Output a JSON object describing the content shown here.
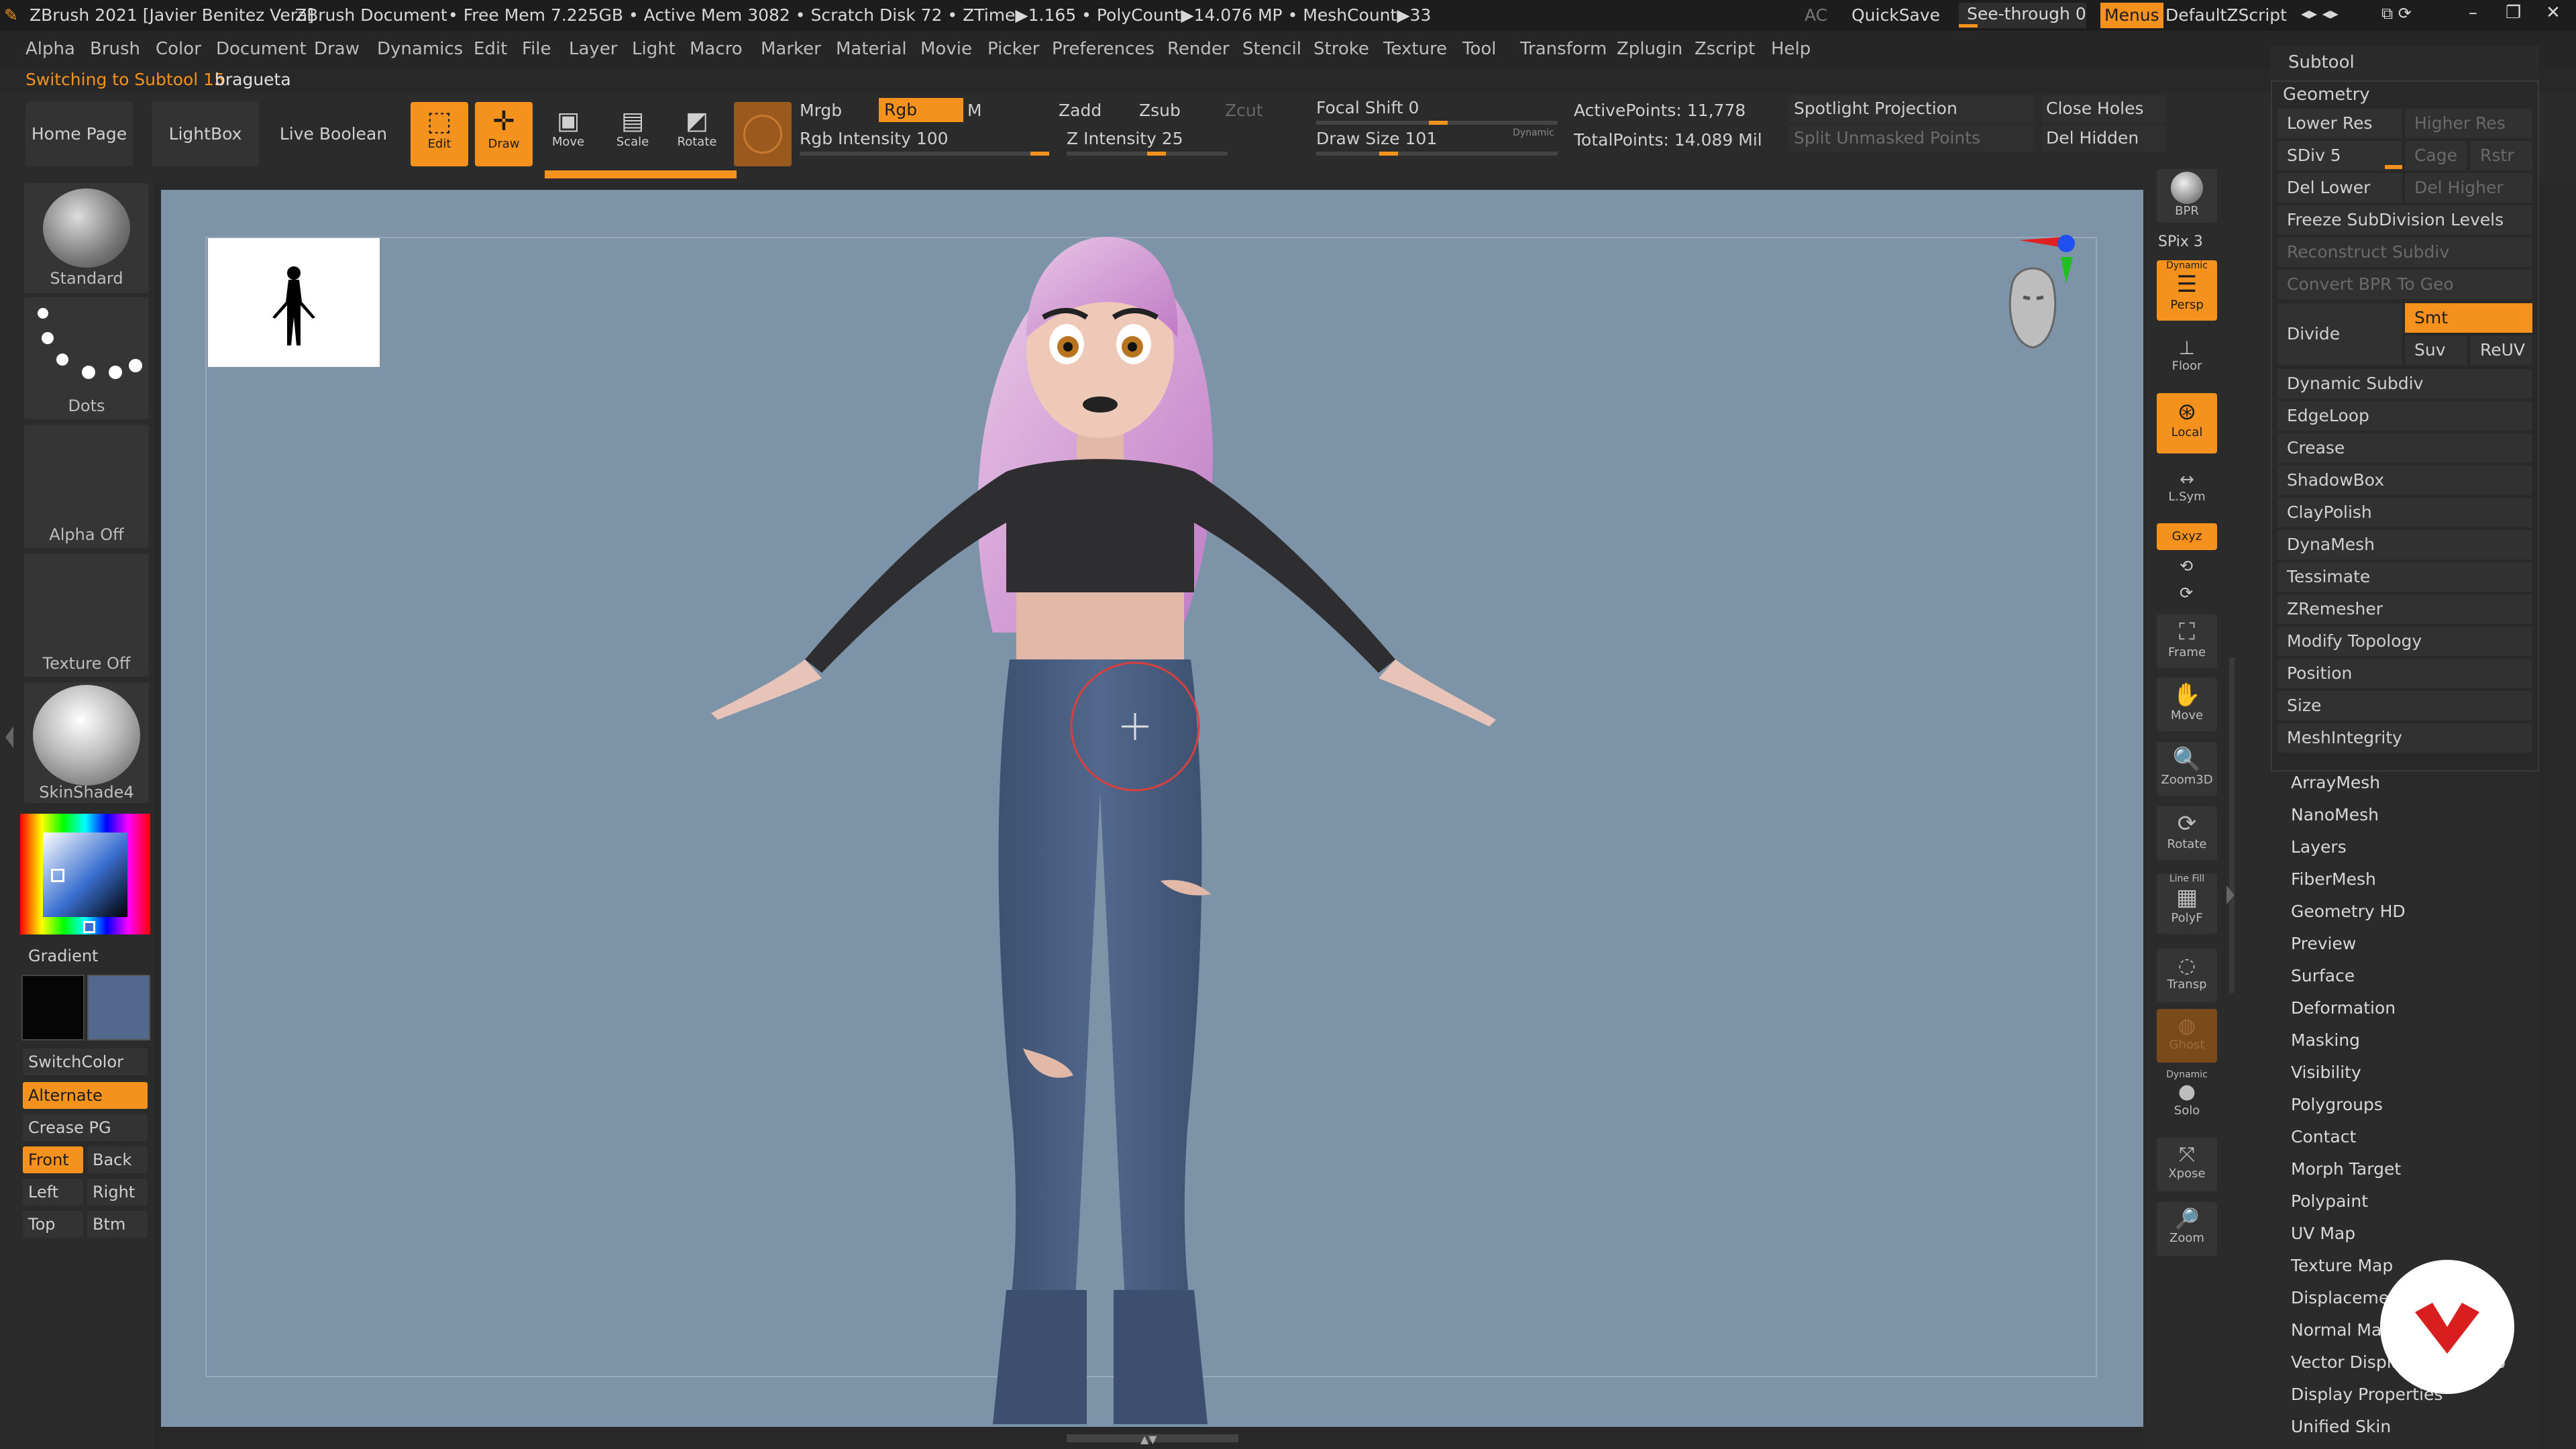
{
  "titlebar": {
    "app": "ZBrush 2021 [Javier Benitez Vera]",
    "doc": "ZBrush Document",
    "stats": "• Free Mem 7.225GB • Active Mem 3082 • Scratch Disk 72 • ZTime▶1.165 • PolyCount▶14.076 MP • MeshCount▶33",
    "ac": "AC",
    "quicksave": "QuickSave",
    "seethrough": "See-through  0",
    "menus": "Menus",
    "zscript": "DefaultZScript"
  },
  "menu": [
    "Alpha",
    "Brush",
    "Color",
    "Document",
    "Draw",
    "Dynamics",
    "Edit",
    "File",
    "Layer",
    "Light",
    "Macro",
    "Marker",
    "Material",
    "Movie",
    "Picker",
    "Preferences",
    "Render",
    "Stencil",
    "Stroke",
    "Texture",
    "Tool",
    "Transform",
    "Zplugin",
    "Zscript",
    "Help"
  ],
  "status": {
    "label": "Switching to Subtool 15:",
    "value": "bragueta"
  },
  "toolbar": {
    "home": "Home Page",
    "lightbox": "LightBox",
    "liveboolean": "Live Boolean",
    "edit": "Edit",
    "draw": "Draw",
    "move": "Move",
    "scale": "Scale",
    "rotate": "Rotate",
    "mrgb": "Mrgb",
    "rgb": "Rgb",
    "m": "M",
    "rgb_intensity": "Rgb Intensity 100",
    "zadd": "Zadd",
    "zsub": "Zsub",
    "zcut": "Zcut",
    "z_intensity": "Z Intensity 25",
    "focal_shift": "Focal Shift 0",
    "draw_size": "Draw Size 101",
    "dynamic": "Dynamic",
    "active_points": "ActivePoints: 11,778",
    "total_points": "TotalPoints: 14.089 Mil",
    "spotlight": "Spotlight Projection",
    "split_unmasked": "Split Unmasked Points",
    "close_holes": "Close Holes",
    "del_hidden": "Del Hidden",
    "rgb_intensity_value": 100,
    "z_intensity_value": 25,
    "draw_size_fill": 0.3
  },
  "left": {
    "standard": "Standard",
    "dots": "Dots",
    "alpha_off": "Alpha Off",
    "texture_off": "Texture Off",
    "material": "SkinShade4",
    "gradient": "Gradient",
    "switchcolor": "SwitchColor",
    "alternate": "Alternate",
    "crease_pg": "Crease PG",
    "front": "Front",
    "back": "Back",
    "left": "Left",
    "right": "Right",
    "top": "Top",
    "btm": "Btm"
  },
  "right_shelf": {
    "bpr": "BPR",
    "spix": "SPix 3",
    "dynamic": "Dynamic",
    "persp": "Persp",
    "floor": "Floor",
    "local": "Local",
    "lsym": "L.Sym",
    "xyz": "Gxyz",
    "frame": "Frame",
    "move": "Move",
    "zoom3d": "Zoom3D",
    "rotate": "Rotate",
    "linefill": "Line Fill",
    "polyf": "PolyF",
    "transp": "Transp",
    "ghost": "Ghost",
    "solo": "Solo",
    "xpose": "Xpose",
    "zoom": "Zoom"
  },
  "palette": {
    "subtool": "Subtool",
    "geometry": "Geometry",
    "lower_res": "Lower Res",
    "higher_res": "Higher Res",
    "sdiv": "SDiv 5",
    "cage": "Cage",
    "rstr": "Rstr",
    "del_lower": "Del Lower",
    "del_higher": "Del Higher",
    "freeze": "Freeze SubDivision Levels",
    "reconstruct": "Reconstruct Subdiv",
    "convert_bpr": "Convert BPR To Geo",
    "divide": "Divide",
    "smt": "Smt",
    "suv": "Suv",
    "reuv": "ReUV",
    "geo_items": [
      "Dynamic Subdiv",
      "EdgeLoop",
      "Crease",
      "ShadowBox",
      "ClayPolish",
      "DynaMesh",
      "Tessimate",
      "ZRemesher",
      "Modify Topology",
      "Position",
      "Size",
      "MeshIntegrity"
    ],
    "sub_items": [
      "ArrayMesh",
      "NanoMesh",
      "Layers",
      "FiberMesh",
      "Geometry HD",
      "Preview",
      "Surface",
      "Deformation",
      "Masking",
      "Visibility",
      "Polygroups",
      "Contact",
      "Morph Target",
      "Polypaint",
      "UV Map",
      "Texture Map",
      "Displacement Map",
      "Normal Map",
      "Vector Displacement Map",
      "Display Properties",
      "Unified Skin"
    ]
  }
}
